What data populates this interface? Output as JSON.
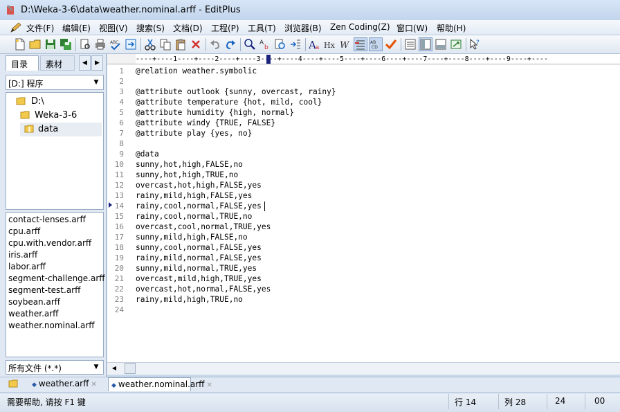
{
  "window": {
    "title": "D:\\Weka-3-6\\data\\weather.nominal.arff - EditPlus"
  },
  "menu": [
    {
      "label": "文件(F)"
    },
    {
      "label": "编辑(E)"
    },
    {
      "label": "视图(V)"
    },
    {
      "label": "搜索(S)"
    },
    {
      "label": "文档(D)"
    },
    {
      "label": "工程(P)"
    },
    {
      "label": "工具(T)"
    },
    {
      "label": "浏览器(B)"
    },
    {
      "label": "Zen Coding(Z)"
    },
    {
      "label": "窗口(W)"
    },
    {
      "label": "帮助(H)"
    }
  ],
  "sidebar": {
    "tabs": [
      "目录",
      "素材"
    ],
    "drive": "[D:] 程序",
    "folders": [
      "D:\\",
      "Weka-3-6",
      "data"
    ],
    "files": [
      "contact-lenses.arff",
      "cpu.arff",
      "cpu.with.vendor.arff",
      "iris.arff",
      "labor.arff",
      "segment-challenge.arff",
      "segment-test.arff",
      "soybean.arff",
      "weather.arff",
      "weather.nominal.arff"
    ],
    "filter": "所有文件 (*.*)"
  },
  "editor": {
    "ruler": "----+----1----+----2----+----3----+----4----+----5----+----6----+----7----+----8----+----9----+----",
    "lines": [
      "@relation weather.symbolic",
      "",
      "@attribute outlook {sunny, overcast, rainy}",
      "@attribute temperature {hot, mild, cool}",
      "@attribute humidity {high, normal}",
      "@attribute windy {TRUE, FALSE}",
      "@attribute play {yes, no}",
      "",
      "@data",
      "sunny,hot,high,FALSE,no",
      "sunny,hot,high,TRUE,no",
      "overcast,hot,high,FALSE,yes",
      "rainy,mild,high,FALSE,yes",
      "rainy,cool,normal,FALSE,yes",
      "rainy,cool,normal,TRUE,no",
      "overcast,cool,normal,TRUE,yes",
      "sunny,mild,high,FALSE,no",
      "sunny,cool,normal,FALSE,yes",
      "rainy,mild,normal,FALSE,yes",
      "sunny,mild,normal,TRUE,yes",
      "overcast,mild,high,TRUE,yes",
      "overcast,hot,normal,FALSE,yes",
      "rainy,mild,high,TRUE,no",
      ""
    ],
    "current_line": 14
  },
  "doc_tabs": [
    {
      "label": "weather.arff"
    },
    {
      "label": "weather.nominal.arff",
      "active": true
    }
  ],
  "status": {
    "help": "需要帮助, 请按 F1 键",
    "line": "行 14",
    "col": "列 28",
    "field3": "24",
    "field4": "00"
  },
  "colors": {
    "accent": "#1a237e",
    "folder": "#f2c94c"
  }
}
